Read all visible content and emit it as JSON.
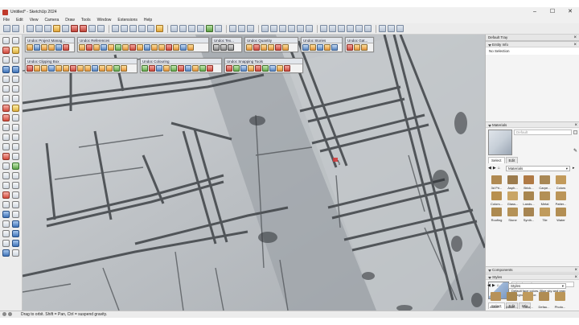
{
  "window": {
    "title": "Untitled* - SketchUp 2024",
    "minimize": "–",
    "maximize": "☐",
    "close": "✕"
  },
  "menu": [
    "File",
    "Edit",
    "View",
    "Camera",
    "Draw",
    "Tools",
    "Window",
    "Extensions",
    "Help"
  ],
  "floating_toolbars": [
    {
      "title": "Undoc Project Manag..."
    },
    {
      "title": "Undoc References"
    },
    {
      "title": "Undoc Tex..."
    },
    {
      "title": "Undoc Quantity"
    },
    {
      "title": "Undoc Stories"
    },
    {
      "title": "Undoc Gat..."
    },
    {
      "title": "Undoc Clipping Box"
    },
    {
      "title": "Undoc Colouring"
    },
    {
      "title": "Undoc Snapping Tools"
    }
  ],
  "tray": {
    "title": "Default Tray",
    "entity_info": {
      "header": "Entity Info",
      "selection": "No Selection"
    },
    "materials": {
      "header": "Materials",
      "name_placeholder": "Default",
      "tabs": [
        "Select",
        "Edit"
      ],
      "library": "Materials",
      "swatches": [
        {
          "label": "3d Pri...",
          "color": "#b08a52"
        },
        {
          "label": "Asph...",
          "color": "#9c7c4e"
        },
        {
          "label": "Brick...",
          "color": "#b07a45"
        },
        {
          "label": "Carpe...",
          "color": "#a98855"
        },
        {
          "label": "Colors",
          "color": "#c29a5a"
        },
        {
          "label": "Colors...",
          "color": "#b8904f"
        },
        {
          "label": "Glass...",
          "color": "#c9a566"
        },
        {
          "label": "Lands...",
          "color": "#a8864f"
        },
        {
          "label": "Metal",
          "color": "#b39055"
        },
        {
          "label": "Patter...",
          "color": "#bb9558"
        },
        {
          "label": "Roofing",
          "color": "#ad8a50"
        },
        {
          "label": "Stone",
          "color": "#b59257"
        },
        {
          "label": "Synth...",
          "color": "#a78552"
        },
        {
          "label": "Tile",
          "color": "#c09b5d"
        },
        {
          "label": "Water",
          "color": "#b38f54"
        }
      ]
    },
    "components": {
      "header": "Components"
    },
    "styles": {
      "header": "Styles",
      "style_name": "Simple Style",
      "description": "Default face colors. Blue sky and gray background color.",
      "tabs": [
        "Select",
        "Edit",
        "Mix"
      ],
      "library": "Styles",
      "swatches": [
        {
          "label": "Assort...",
          "color": "#b7925a"
        },
        {
          "label": "Assort...",
          "color": "#a9884f"
        },
        {
          "label": "Color...",
          "color": "#c09a5b"
        },
        {
          "label": "Defau...",
          "color": "#b08c53"
        },
        {
          "label": "Photo...",
          "color": "#bb9658"
        }
      ]
    }
  },
  "statusbar": {
    "text": "Drag to orbit. Shift = Pan, Ctrl = suspend gravity."
  }
}
